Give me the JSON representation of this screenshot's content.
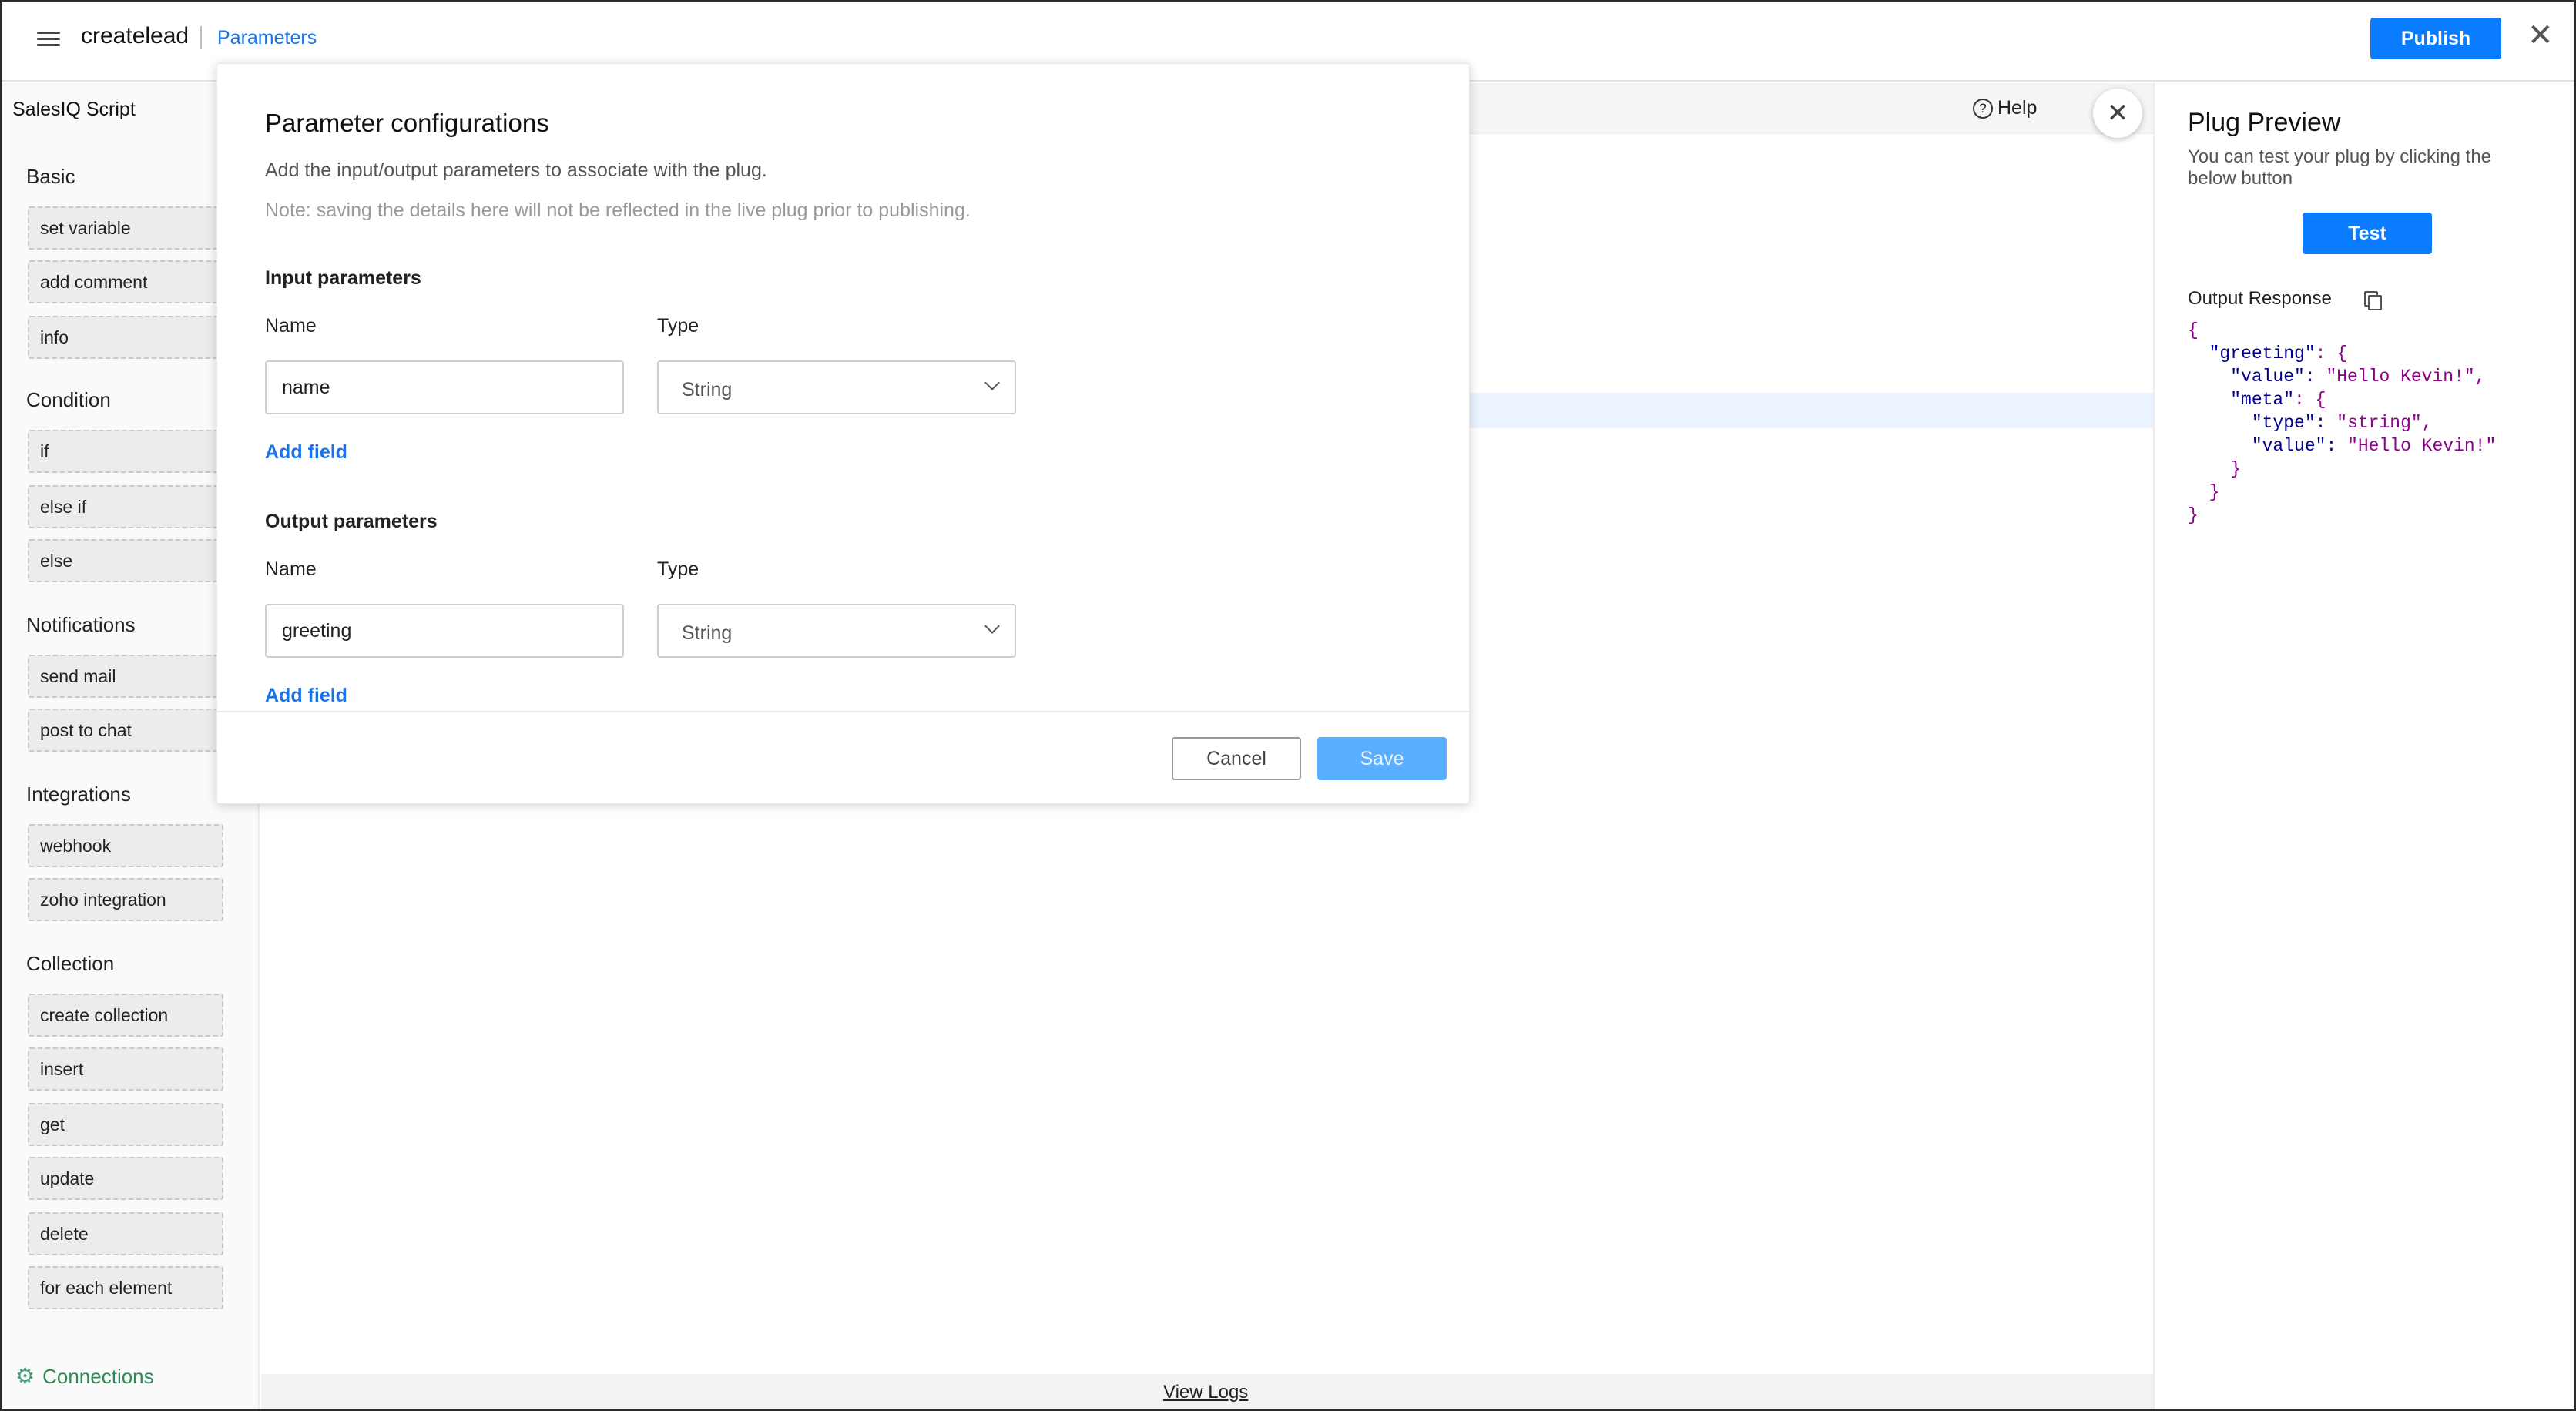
{
  "header": {
    "app_title": "createlead",
    "breadcrumb": "Parameters",
    "publish_label": "Publish",
    "close_glyph": "✕"
  },
  "sidebar": {
    "title": "SalesIQ Script",
    "sections": [
      {
        "title": "Basic",
        "items": [
          "set variable",
          "add comment",
          "info"
        ]
      },
      {
        "title": "Condition",
        "items": [
          "if",
          "else if",
          "else"
        ]
      },
      {
        "title": "Notifications",
        "items": [
          "send mail",
          "post to chat"
        ]
      },
      {
        "title": "Integrations",
        "items": [
          "webhook",
          "zoho integration"
        ]
      },
      {
        "title": "Collection",
        "items": [
          "create collection",
          "insert",
          "get",
          "update",
          "delete",
          "for each element"
        ]
      }
    ],
    "connections_label": "Connections",
    "connections_icon": "gear-icon"
  },
  "editor": {
    "help_label": "Help",
    "help_icon": "?",
    "view_logs": "View Logs"
  },
  "preview": {
    "title": "Plug Preview",
    "description": "You can test your plug by clicking the below button",
    "test_label": "Test",
    "output_label": "Output Response",
    "output_json": {
      "l1": "{",
      "l2k": "\"greeting\"",
      "l2r": ": {",
      "l3k": "\"value\"",
      "l3v": "\"Hello Kevin!\"",
      "l4k": "\"meta\"",
      "l4r": ": {",
      "l5k": "\"type\"",
      "l5v": "\"string\"",
      "l6k": "\"value\"",
      "l6v": "\"Hello Kevin!\"",
      "l7": "}",
      "l8": "}",
      "l9": "}"
    }
  },
  "modal": {
    "title": "Parameter configurations",
    "description": "Add the input/output parameters to associate with the plug.",
    "note": "Note: saving the details here will not be reflected in the live plug prior to publishing.",
    "input": {
      "title": "Input parameters",
      "name_label": "Name",
      "type_label": "Type",
      "name_value": "name",
      "type_value": "String",
      "add_field": "Add field"
    },
    "output": {
      "title": "Output parameters",
      "name_label": "Name",
      "type_label": "Type",
      "name_value": "greeting",
      "type_value": "String",
      "add_field": "Add field"
    },
    "cancel_label": "Cancel",
    "save_label": "Save",
    "close_glyph": "✕"
  },
  "colors": {
    "accent": "#0a7cff",
    "link": "#1a73e8",
    "save_disabled": "#5aaeff",
    "connections": "#2e8b57"
  }
}
